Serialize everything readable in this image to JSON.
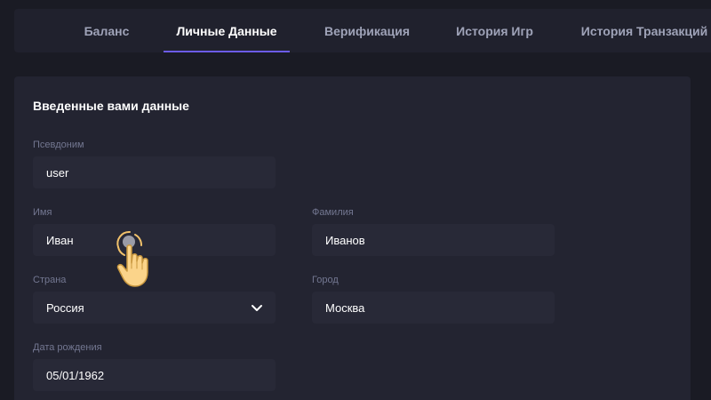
{
  "tabs": [
    {
      "label": "Баланс",
      "active": false
    },
    {
      "label": "Личные Данные",
      "active": true
    },
    {
      "label": "Верификация",
      "active": false
    },
    {
      "label": "История Игр",
      "active": false
    },
    {
      "label": "История Транзакций",
      "active": false
    }
  ],
  "form": {
    "title": "Введенные вами данные",
    "nickname": {
      "label": "Псевдоним",
      "value": "user"
    },
    "first_name": {
      "label": "Имя",
      "value": "Иван"
    },
    "last_name": {
      "label": "Фамилия",
      "value": "Иванов"
    },
    "country": {
      "label": "Страна",
      "value": "Россия"
    },
    "city": {
      "label": "Город",
      "value": "Москва"
    },
    "birth_date": {
      "label": "Дата рождения",
      "value": "05/01/1962"
    }
  },
  "colors": {
    "background": "#1a1b24",
    "panel": "#232431",
    "input": "#282937",
    "accent": "#6c5ce7",
    "label": "#737791",
    "tab_inactive": "#9fa3b8"
  },
  "icons": {
    "country_dropdown": "chevron-down-icon",
    "tap_hint": "tap-hand-icon"
  }
}
